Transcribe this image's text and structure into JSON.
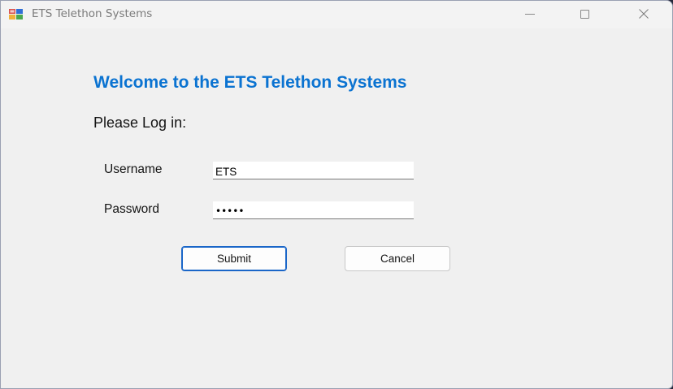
{
  "window": {
    "title": "ETS Telethon Systems",
    "icon": "windows-form-icon",
    "controls": [
      "minimize-icon",
      "maximize-icon",
      "close-icon"
    ]
  },
  "form": {
    "welcome_heading": "Welcome to the ETS Telethon Systems",
    "login_prompt": "Please Log in:",
    "username_label": "Username",
    "username_value": "ETS",
    "password_label": "Password",
    "password_value": "•••••",
    "submit_label": "Submit",
    "cancel_label": "Cancel"
  },
  "colors": {
    "heading": "#0b73d1",
    "focused_button_border": "#1a66c8",
    "window_background": "#f0f0f0"
  }
}
